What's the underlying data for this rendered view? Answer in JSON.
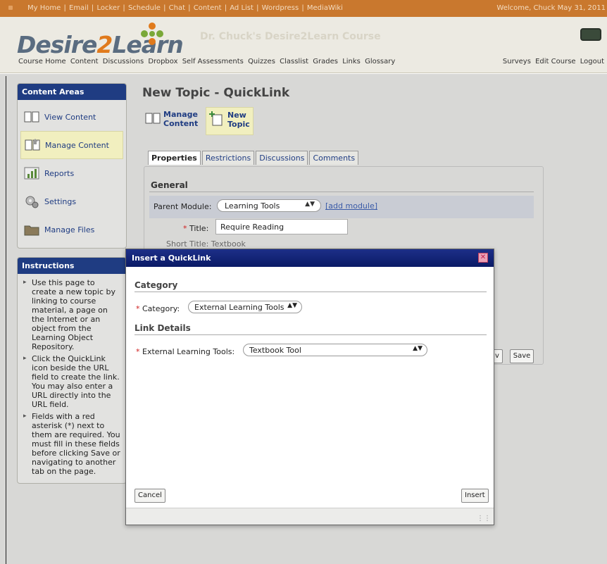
{
  "topnav": {
    "links": [
      "My Home",
      "Email",
      "Locker",
      "Schedule",
      "Chat",
      "Content",
      "Ad List",
      "Wordpress",
      "MediaWiki"
    ],
    "welcome": "Welcome, Chuck May 31, 2011"
  },
  "header": {
    "logo_part1": "Desire",
    "logo_part2": "2",
    "logo_part3": "Learn",
    "course_title": "Dr. Chuck's Desire2Learn Course",
    "course_nav": [
      "Course Home",
      "Content",
      "Discussions",
      "Dropbox",
      "Self Assessments",
      "Quizzes",
      "Classlist",
      "Grades",
      "Links",
      "Glossary"
    ],
    "right_nav": [
      "Surveys",
      "Edit Course",
      "Logout"
    ]
  },
  "sidebar": {
    "content_areas_title": "Content Areas",
    "items": [
      {
        "label": "View Content",
        "icon": "book-icon"
      },
      {
        "label": "Manage Content",
        "icon": "manage-book-icon"
      },
      {
        "label": "Reports",
        "icon": "chart-icon"
      },
      {
        "label": "Settings",
        "icon": "gear-icon"
      },
      {
        "label": "Manage Files",
        "icon": "folder-icon"
      }
    ],
    "instructions_title": "Instructions",
    "instructions": [
      "Use this page to create a new topic by linking to course material, a page on the Internet or an object from the Learning Object Repository.",
      "Click the QuickLink icon beside the URL field to create the link. You may also enter a URL directly into the URL field.",
      "Fields with a red asterisk (*) next to them are required. You must fill in these fields before clicking Save or navigating to another tab on the page."
    ]
  },
  "main": {
    "title": "New Topic - QuickLink",
    "actions": [
      {
        "label_line1": "Manage",
        "label_line2": "Content"
      },
      {
        "label_line1": "New",
        "label_line2": "Topic"
      }
    ],
    "tabs": [
      "Properties",
      "Restrictions",
      "Discussions",
      "Comments"
    ],
    "section_general": "General",
    "parent_module_label": "Parent Module:",
    "parent_module_value": "Learning Tools",
    "add_module": "[add module]",
    "title_label": "Title:",
    "title_value": "Require Reading",
    "short_title_label": "Short Title:",
    "short_title_value": "Textbook",
    "v_label": "v",
    "save_label": "Save"
  },
  "modal": {
    "title": "Insert a QuickLink",
    "section_category": "Category",
    "category_label": "Category:",
    "category_value": "External Learning Tools",
    "section_link_details": "Link Details",
    "elt_label": "External Learning Tools:",
    "elt_value": "Textbook Tool",
    "cancel_label": "Cancel",
    "insert_label": "Insert"
  }
}
